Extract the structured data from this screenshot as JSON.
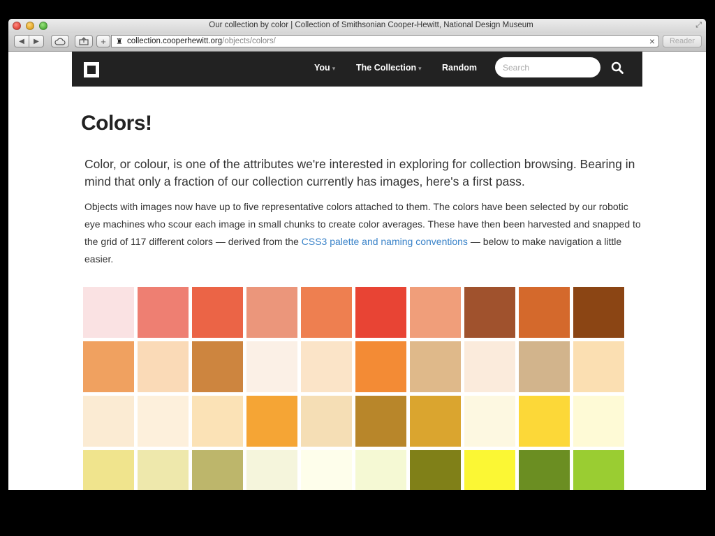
{
  "window": {
    "title": "Our collection by color | Collection of Smithsonian Cooper-Hewitt, National Design Museum"
  },
  "toolbar": {
    "url_domain": "collection.cooperhewitt.org",
    "url_path": "/objects/colors/",
    "reader_label": "Reader"
  },
  "nav": {
    "items": [
      {
        "label": "You",
        "has_caret": true
      },
      {
        "label": "The Collection",
        "has_caret": true
      },
      {
        "label": "Random",
        "has_caret": false
      }
    ],
    "search_placeholder": "Search"
  },
  "content": {
    "title": "Colors!",
    "lead": "Color, or colour, is one of the attributes we're interested in exploring for collection browsing. Bearing in mind that only a fraction of our collection currently has images, here's a first pass.",
    "body_before_link": "Objects with images now have up to five representative colors attached to them. The colors have been selected by our robotic eye machines who scour each image in small chunks to create color averages. These have then been harvested and snapped to the grid of 117 different colors — derived from the ",
    "link_text": "CSS3 palette and naming conventions",
    "body_after_link": " — below to make navigation a little easier."
  },
  "swatches": [
    "#fae2e3",
    "#ee7f72",
    "#eb6446",
    "#eb967b",
    "#ee7f50",
    "#e84434",
    "#f09e7a",
    "#a0522d",
    "#d4692c",
    "#8b4514",
    "#f0a160",
    "#fadab7",
    "#cd853f",
    "#fbf0e6",
    "#fbe4c8",
    "#f38b35",
    "#dfb98a",
    "#fbebdc",
    "#d2b48c",
    "#fbdfb2",
    "#fbebd3",
    "#fdf0dc",
    "#fbe2b6",
    "#f5a535",
    "#f5deb5",
    "#b8862a",
    "#daa52f",
    "#fdf8e1",
    "#fcd838",
    "#fefad6",
    "#f0e48d",
    "#eee8ac",
    "#bdb66b",
    "#f5f5dc",
    "#fefeeb",
    "#f5f9d4",
    "#808018",
    "#fbf734",
    "#6b8e22",
    "#9acd32"
  ]
}
